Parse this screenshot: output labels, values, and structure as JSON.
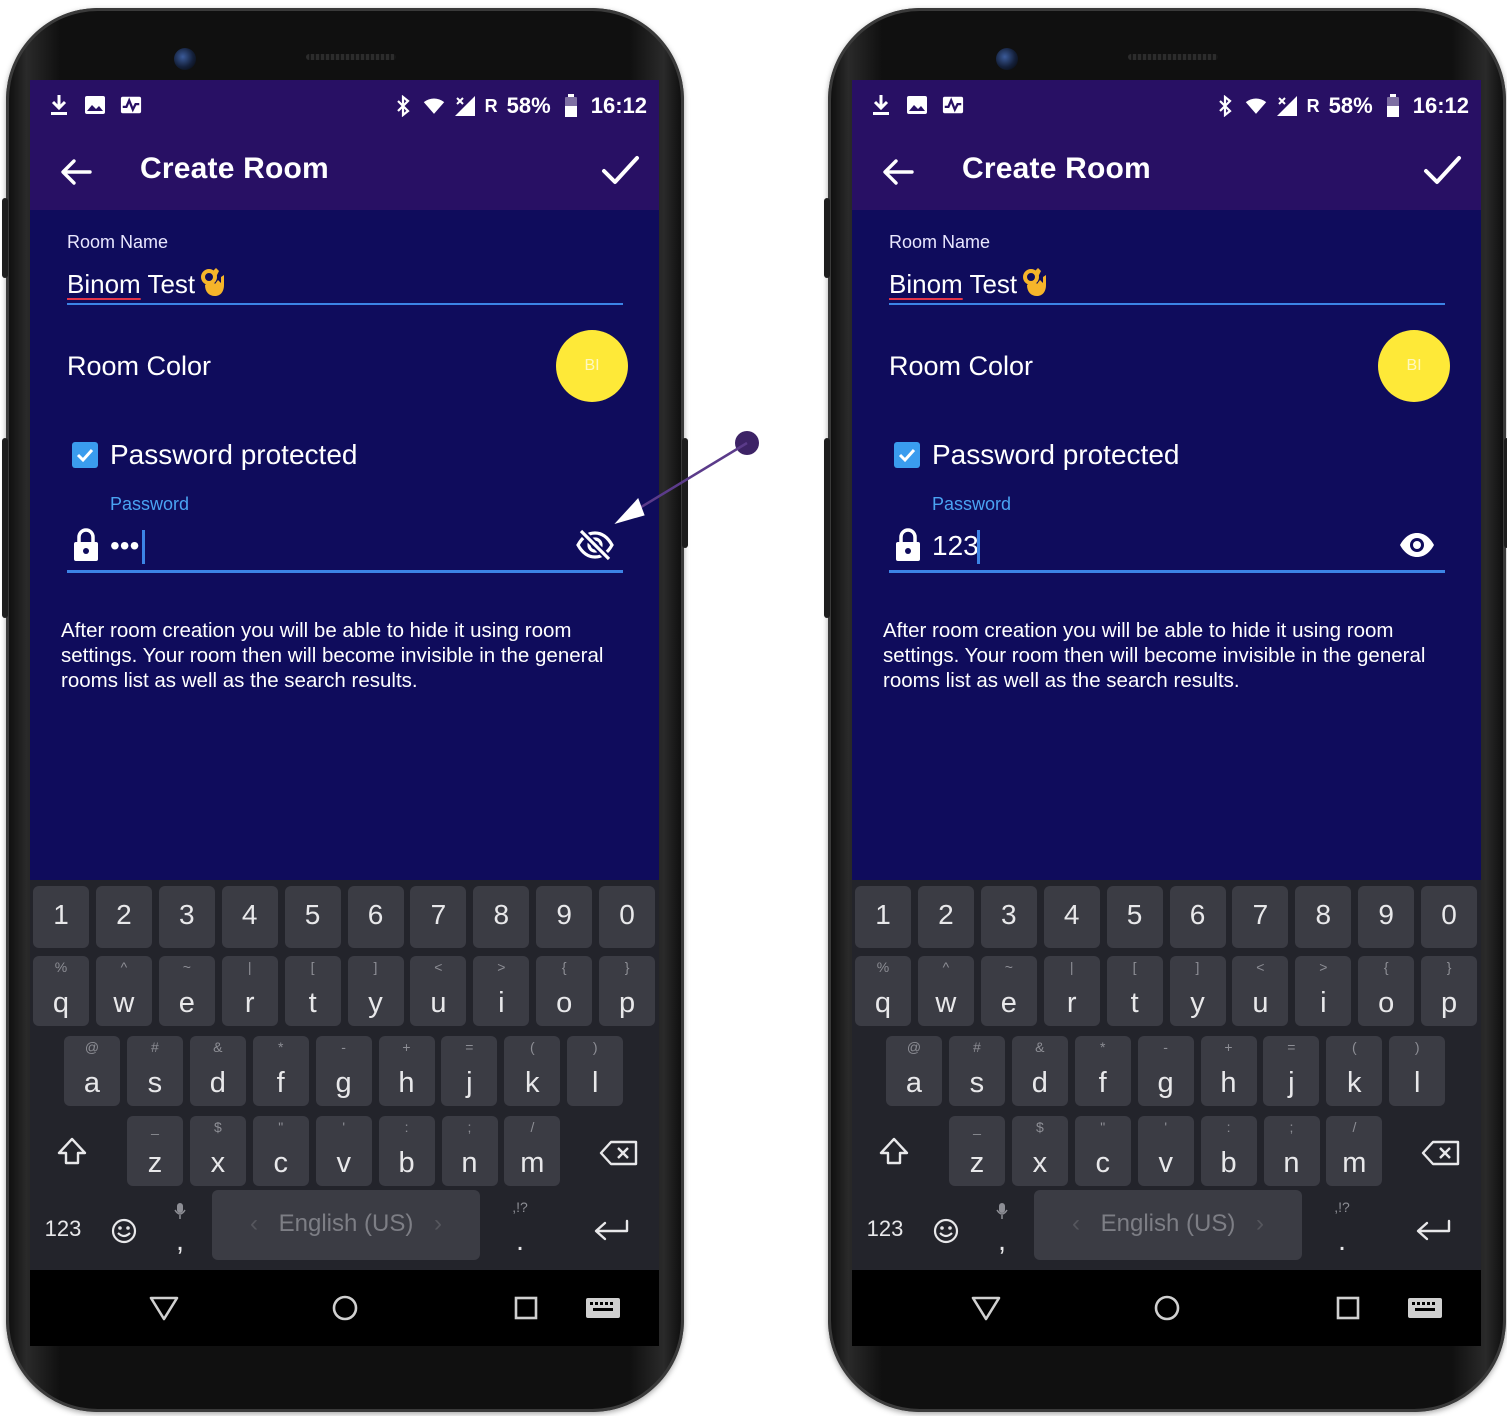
{
  "colors": {
    "primary": "#281064",
    "background": "#0f0c5c",
    "accent": "#3c84e6",
    "room_color": "#fee938",
    "annotation": "#3d2366"
  },
  "annotation": {
    "icon": "arrow-callout-icon"
  },
  "left": {
    "statusbar": {
      "battery": "58%",
      "time": "16:12",
      "network_label": "R"
    },
    "appbar": {
      "title": "Create Room"
    },
    "form": {
      "room_name_label": "Room Name",
      "room_name_underlined": "Binom",
      "room_name_rest": " Test",
      "room_color_label": "Room Color",
      "room_color_initials": "BI",
      "password_protected_label": "Password protected",
      "password_protected_checked": true,
      "password_hint": "Password",
      "password_value": "•••",
      "password_visibility_icon": "eye-off-icon",
      "info_text": "After room creation you will be able to hide it using room settings. Your room then will become invisible in the general rooms list as well as the search results."
    }
  },
  "right": {
    "statusbar": {
      "battery": "58%",
      "time": "16:12",
      "network_label": "R"
    },
    "appbar": {
      "title": "Create Room"
    },
    "form": {
      "room_name_label": "Room Name",
      "room_name_underlined": "Binom",
      "room_name_rest": " Test",
      "room_color_label": "Room Color",
      "room_color_initials": "BI",
      "password_protected_label": "Password protected",
      "password_protected_checked": true,
      "password_hint": "Password",
      "password_value": "123",
      "password_visibility_icon": "eye-icon",
      "info_text": "After room creation you will be able to hide it using room settings. Your room then will become invisible in the general rooms list as well as the search results."
    }
  },
  "keyboard": {
    "number_row": [
      "1",
      "2",
      "3",
      "4",
      "5",
      "6",
      "7",
      "8",
      "9",
      "0"
    ],
    "row1": [
      {
        "k": "q",
        "h": "%"
      },
      {
        "k": "w",
        "h": "^"
      },
      {
        "k": "e",
        "h": "~"
      },
      {
        "k": "r",
        "h": "|"
      },
      {
        "k": "t",
        "h": "["
      },
      {
        "k": "y",
        "h": "]"
      },
      {
        "k": "u",
        "h": "<"
      },
      {
        "k": "i",
        "h": ">"
      },
      {
        "k": "o",
        "h": "{"
      },
      {
        "k": "p",
        "h": "}"
      }
    ],
    "row2": [
      {
        "k": "a",
        "h": "@"
      },
      {
        "k": "s",
        "h": "#"
      },
      {
        "k": "d",
        "h": "&"
      },
      {
        "k": "f",
        "h": "*"
      },
      {
        "k": "g",
        "h": "-"
      },
      {
        "k": "h",
        "h": "+"
      },
      {
        "k": "j",
        "h": "="
      },
      {
        "k": "k",
        "h": "("
      },
      {
        "k": "l",
        "h": ")"
      }
    ],
    "row3": [
      {
        "k": "z",
        "h": "_"
      },
      {
        "k": "x",
        "h": "$"
      },
      {
        "k": "c",
        "h": "\""
      },
      {
        "k": "v",
        "h": "'"
      },
      {
        "k": "b",
        "h": ":"
      },
      {
        "k": "n",
        "h": ";"
      },
      {
        "k": "m",
        "h": "/"
      }
    ],
    "symbols_key": "123",
    "comma_key": ",",
    "space_label": "English (US)",
    "space_left_arrow": "‹",
    "space_right_arrow": "›",
    "period_key": ".",
    "period_hint": ",!?"
  }
}
